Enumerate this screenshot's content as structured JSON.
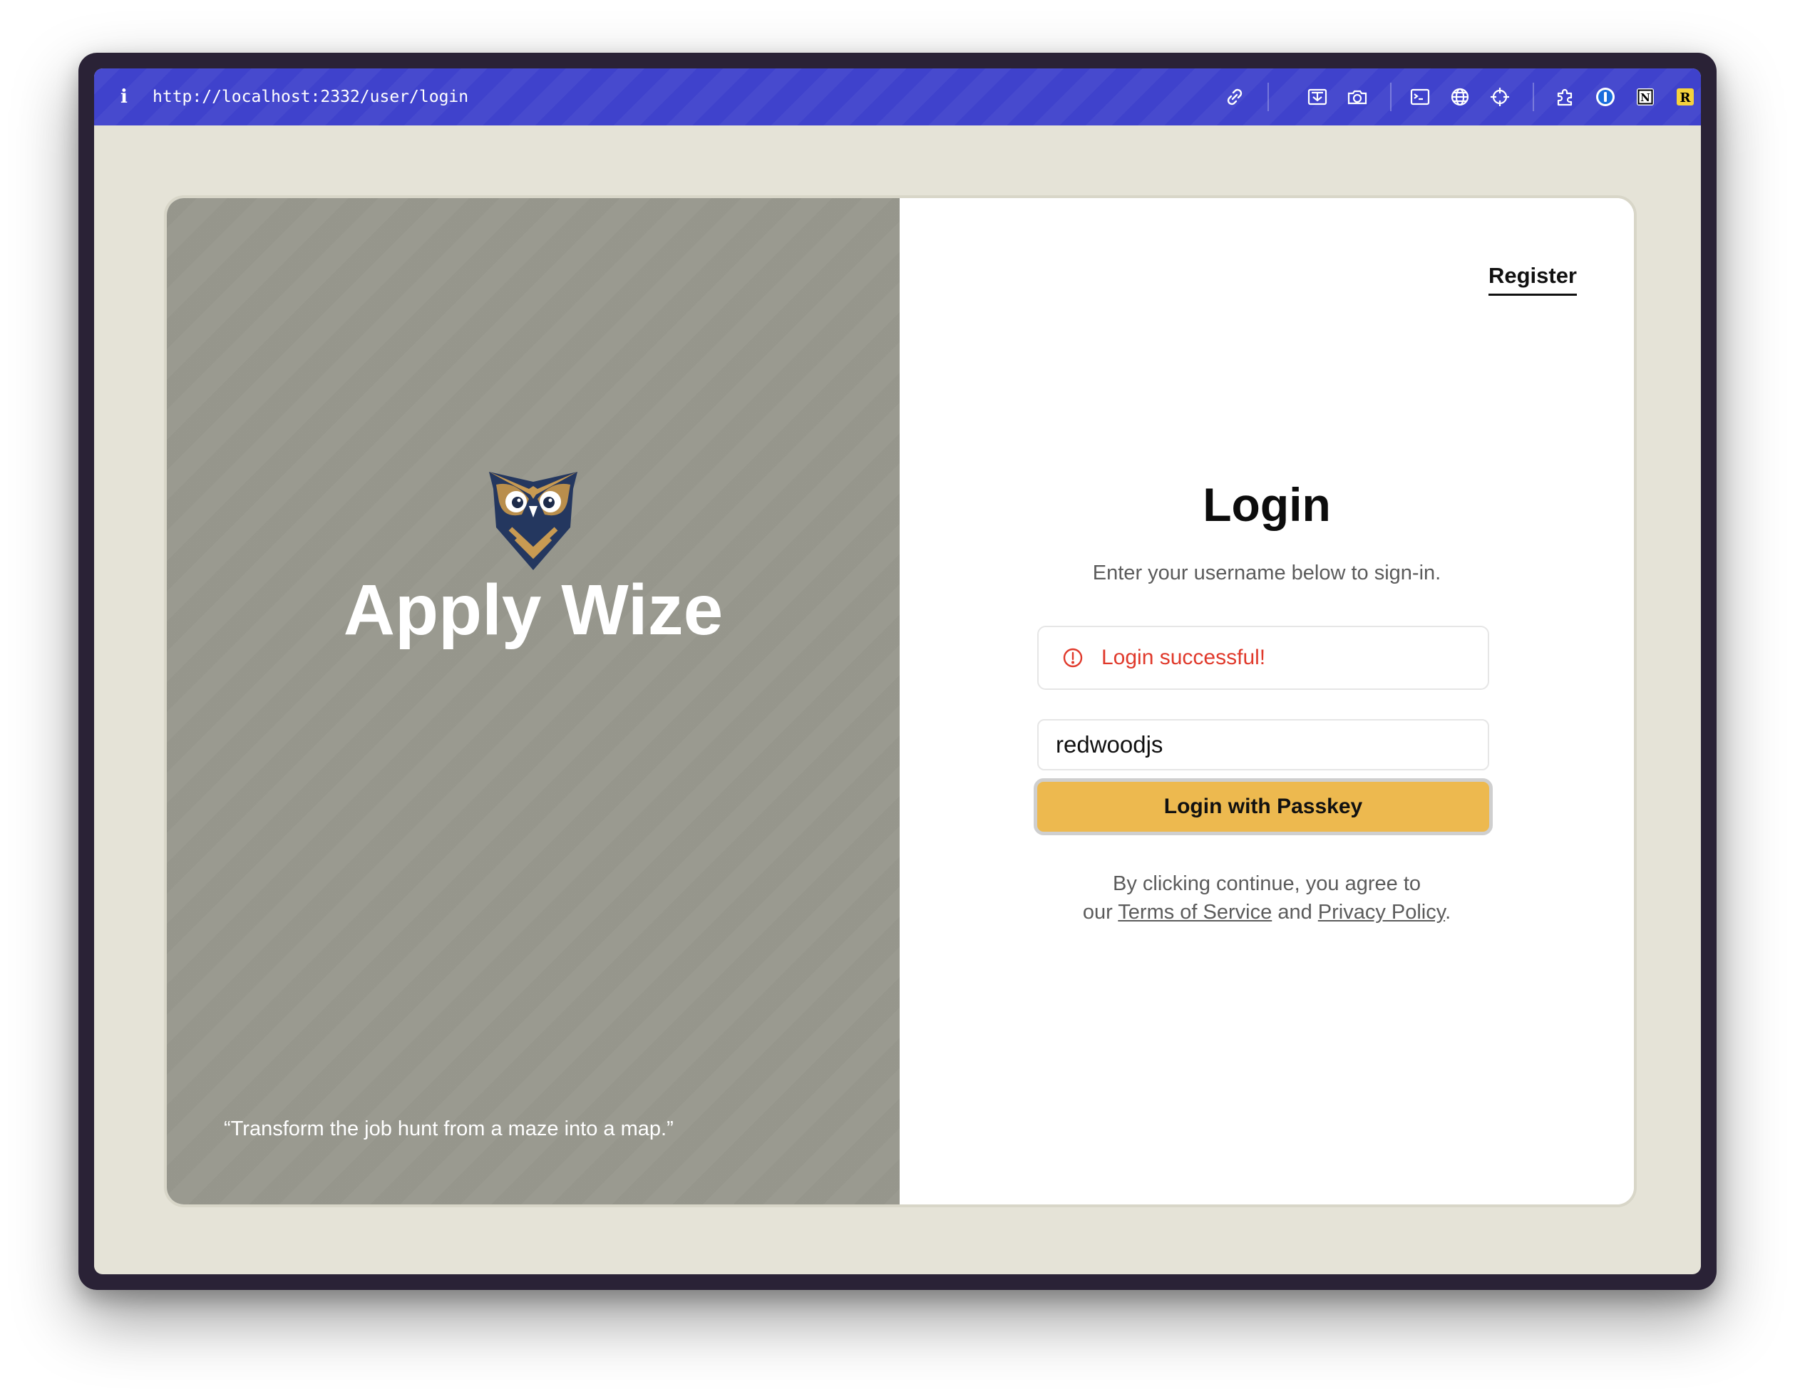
{
  "browser": {
    "url": "http://localhost:2332/user/login",
    "info_icon": "i",
    "toolbar_icons": [
      "link-icon",
      "screenshot-icon",
      "camera-icon",
      "terminal-icon",
      "globe-icon",
      "crosshair-icon",
      "extensions-icon",
      "1password-icon",
      "notion-icon",
      "readwise-icon",
      "cloud-icon",
      "sidebar-icon"
    ],
    "notion_glyph": "N",
    "readwise_glyph": "R",
    "toolbar_color": "#3f42cc"
  },
  "brand": {
    "name": "Apply Wize",
    "quote": "“Transform the job hunt from a maze into a map.”",
    "panel_color": "#9a9a90",
    "logo": "owl-logo"
  },
  "nav": {
    "register": "Register"
  },
  "login": {
    "title": "Login",
    "subtitle": "Enter your username below to sign-in.",
    "alert_text": "Login successful!",
    "alert_color": "#e0392b",
    "username_value": "redwoodjs",
    "button_label": "Login with Passkey",
    "button_color": "#edb94f",
    "legal_line1": "By clicking continue, you agree to",
    "legal_prefix": "our",
    "terms_link": "Terms of Service",
    "legal_and": "and",
    "privacy_link": "Privacy Policy",
    "legal_end": "."
  }
}
